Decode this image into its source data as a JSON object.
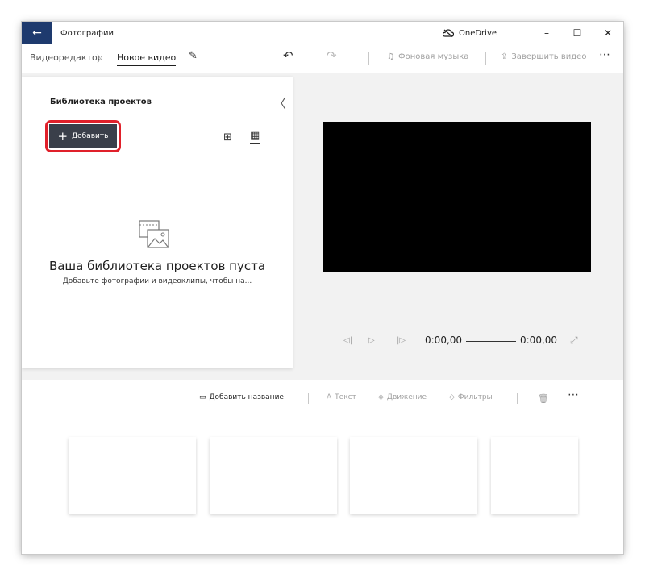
{
  "titlebar": {
    "back_icon": "←",
    "app_title": "Фотографии",
    "onedrive_label": "OneDrive",
    "minimize": "–",
    "maximize": "☐",
    "close": "✕"
  },
  "toolbar": {
    "breadcrumb_root": "Видеоредактор",
    "breadcrumb_sep": "〉",
    "project_name": "Новое видео",
    "rename_icon": "✎",
    "undo_icon": "↶",
    "redo_icon": "↷",
    "music_icon": "♫",
    "music_label": "Фоновая музыка",
    "finish_icon": "⇪",
    "finish_label": "Завершить видео",
    "more_icon": "⋯"
  },
  "library": {
    "title": "Библиотека проектов",
    "collapse_icon": "〈",
    "add_plus": "+",
    "add_label": "Добавить",
    "grid_view_icon": "⊞",
    "list_view_icon": "▦",
    "empty_title": "Ваша библиотека проектов пуста",
    "empty_subtitle": "Добавьте фотографии и видеоклипы, чтобы на..."
  },
  "player": {
    "prev_icon": "◁|",
    "play_icon": "▷",
    "next_icon": "|▷",
    "current_time": "0:00,00",
    "total_time": "0:00,00",
    "fullscreen_icon": "⤢"
  },
  "storyboard": {
    "title_icon": "▭",
    "title_label": "Добавить название",
    "text_icon": "A",
    "text_label": "Текст",
    "motion_icon": "◈",
    "motion_label": "Движение",
    "filters_icon": "◇",
    "filters_label": "Фильтры",
    "delete_icon": "🗑",
    "more_icon": "⋯"
  },
  "colors": {
    "accent_titlebar": "#1e3a6e",
    "add_button": "#3a3f4a",
    "highlight": "#e0202a"
  }
}
